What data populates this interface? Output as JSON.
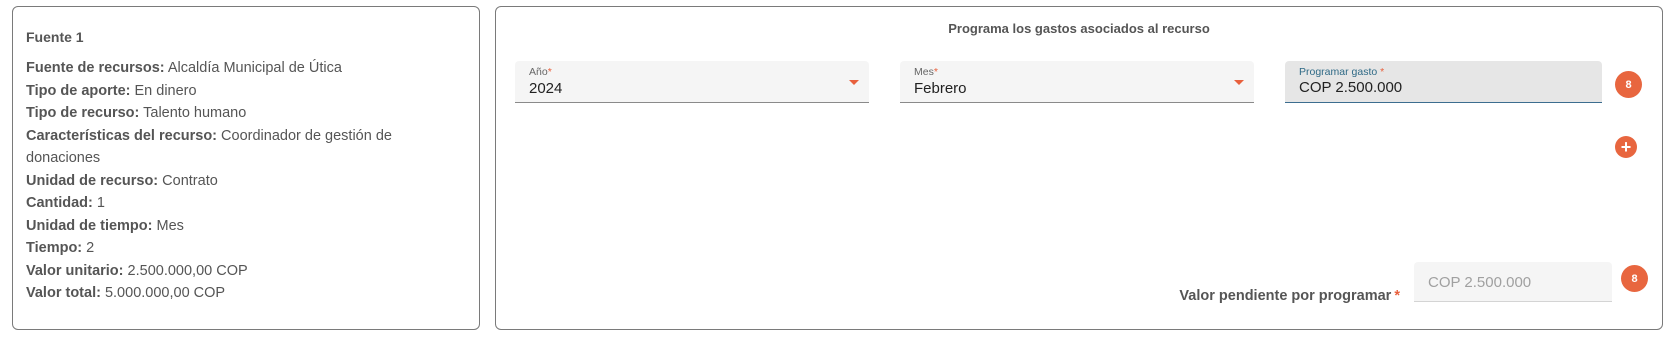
{
  "source_card": {
    "title": "Fuente 1",
    "rows": [
      {
        "label": "Fuente de recursos:",
        "value": "Alcaldía Municipal de Útica"
      },
      {
        "label": "Tipo de aporte:",
        "value": "En dinero"
      },
      {
        "label": "Tipo de recurso:",
        "value": "Talento humano"
      },
      {
        "label": "Características del recurso:",
        "value": "Coordinador de gestión de donaciones"
      },
      {
        "label": "Unidad de recurso:",
        "value": "Contrato"
      },
      {
        "label": "Cantidad:",
        "value": "1"
      },
      {
        "label": "Unidad de tiempo:",
        "value": "Mes"
      },
      {
        "label": "Tiempo:",
        "value": "2"
      },
      {
        "label": "Valor unitario:",
        "value": "2.500.000,00 COP"
      },
      {
        "label": "Valor total:",
        "value": "5.000.000,00 COP"
      }
    ]
  },
  "schedule": {
    "title": "Programa los gastos asociados al recurso",
    "required_mark": "*",
    "year": {
      "label": "Año",
      "value": "2024"
    },
    "month": {
      "label": "Mes",
      "value": "Febrero"
    },
    "expense": {
      "label": "Programar gasto",
      "value": "COP 2.500.000"
    },
    "expense_badge": "8",
    "add_icon": "plus-circle-icon",
    "add_symbol": "+",
    "pending": {
      "label": "Valor pendiente por programar",
      "value": "COP 2.500.000",
      "badge": "8"
    }
  },
  "colors": {
    "accent": "#e8663f",
    "focus": "#3c6d8f",
    "text": "#555555"
  }
}
